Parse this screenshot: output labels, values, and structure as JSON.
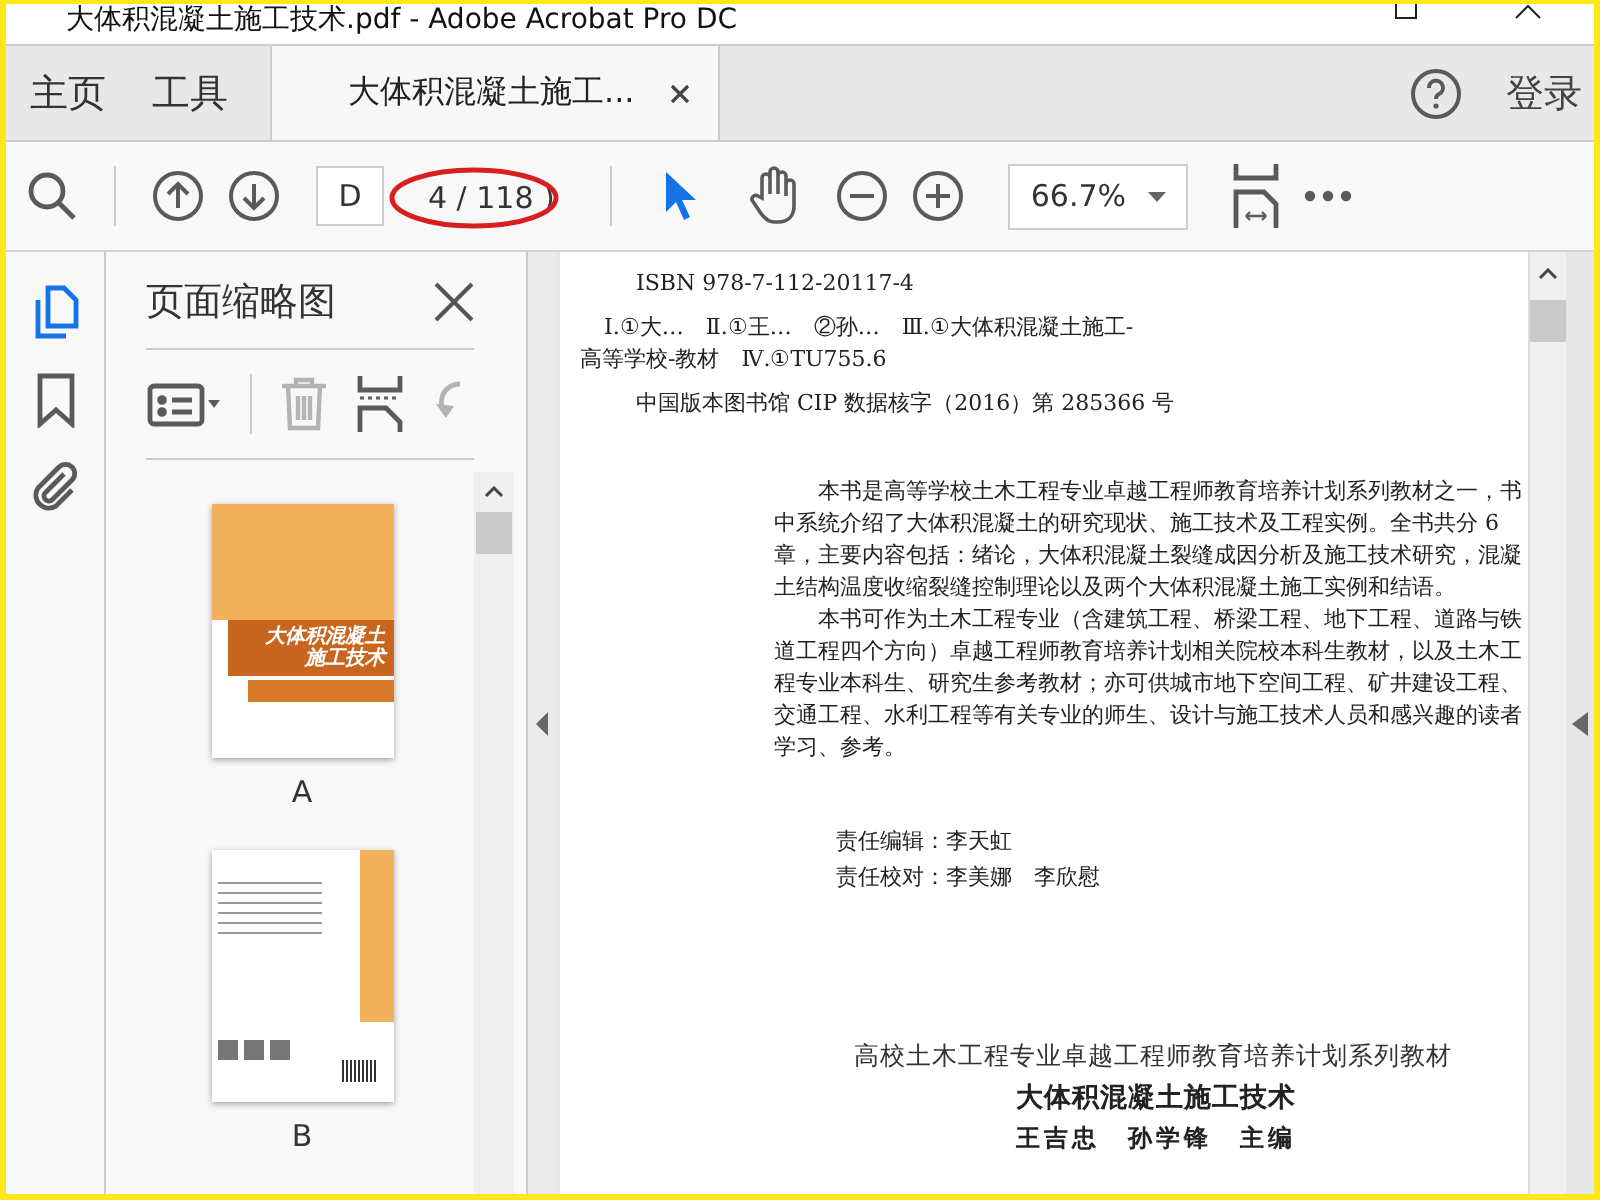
{
  "window": {
    "title": "大体积混凝土施工技术.pdf - Adobe Acrobat Pro DC"
  },
  "tabs": [
    {
      "label": "主页",
      "kind": "nav",
      "selected": false
    },
    {
      "label": "工具",
      "kind": "nav",
      "selected": false
    },
    {
      "label": "大体积混凝土施工...",
      "kind": "document",
      "selected": true
    }
  ],
  "account": {
    "label": "登录"
  },
  "toolbar": {
    "page_field": {
      "value": "D"
    },
    "page_count": "4 / 118 )",
    "tools": [
      {
        "kind": "select",
        "selected": true
      },
      {
        "kind": "hand",
        "selected": false
      }
    ],
    "zoom": {
      "value": "66.7%"
    }
  },
  "sidebar": {
    "rail": [
      {
        "kind": "pages",
        "selected": true
      },
      {
        "kind": "bookmarks",
        "selected": false
      },
      {
        "kind": "attachments",
        "selected": false
      }
    ],
    "panel": {
      "title": "页面缩略图",
      "tools": [
        {
          "kind": "options",
          "disabled": false
        },
        {
          "kind": "delete",
          "disabled": true
        },
        {
          "kind": "split",
          "disabled": false
        },
        {
          "kind": "rotate",
          "disabled": true
        }
      ],
      "thumbnails": [
        {
          "label": "A",
          "kind": "front_cover",
          "cover_title": [
            "大体积混凝土",
            "施工技术"
          ]
        },
        {
          "label": "B",
          "kind": "back_cover"
        }
      ]
    }
  },
  "document": {
    "blocks": [
      {
        "kind": "cip",
        "text": "ISBN 978-7-112-20117-4"
      },
      {
        "kind": "cip_wrap",
        "text": "Ⅰ.①大…　Ⅱ.①王…　②孙…　Ⅲ.①大体积混凝土施工-高等学校-教材　Ⅳ.①TU755.6"
      },
      {
        "kind": "cip",
        "text": "中国版本图书馆 CIP 数据核字（2016）第 285366 号"
      },
      {
        "kind": "abstract",
        "text": "本书是高等学校土木工程专业卓越工程师教育培养计划系列教材之一，书中系统介绍了大体积混凝土的研究现状、施工技术及工程实例。全书共分 6 章，主要内容包括：绪论，大体积混凝土裂缝成因分析及施工技术研究，混凝土结构温度收缩裂缝控制理论以及两个大体积混凝土施工实例和结语。"
      },
      {
        "kind": "abstract",
        "text": "本书可作为土木工程专业（含建筑工程、桥梁工程、地下工程、道路与铁道工程四个方向）卓越工程师教育培养计划相关院校本科生教材，以及土木工程专业本科生、研究生参考教材；亦可供城市地下空间工程、矿井建设工程、交通工程、水利工程等有关专业的师生、设计与施工技术人员和感兴趣的读者学习、参考。"
      },
      {
        "kind": "credit",
        "text": "责任编辑：李天虹"
      },
      {
        "kind": "credit",
        "text": "责任校对：李美娜　李欣慰"
      },
      {
        "kind": "series",
        "text": "高校土木工程专业卓越工程师教育培养计划系列教材"
      },
      {
        "kind": "title",
        "text": "大体积混凝土施工技术"
      },
      {
        "kind": "editors",
        "text": "王吉忠　孙学锋　主编"
      }
    ]
  }
}
